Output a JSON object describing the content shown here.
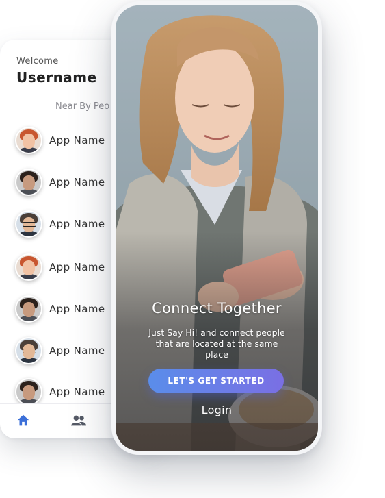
{
  "list_screen": {
    "welcome": "Welcome",
    "username": "Username",
    "section_title": "Near By Peo",
    "items": [
      {
        "label": "App Name",
        "avatar": "red-hair-woman"
      },
      {
        "label": "App Name",
        "avatar": "dark-hair-man"
      },
      {
        "label": "App Name",
        "avatar": "man-with-glasses"
      },
      {
        "label": "App Name",
        "avatar": "red-hair-woman"
      },
      {
        "label": "App Name",
        "avatar": "dark-hair-man"
      },
      {
        "label": "App Name",
        "avatar": "man-with-glasses"
      },
      {
        "label": "App Name",
        "avatar": "dark-hair-man"
      }
    ],
    "tabs": [
      {
        "icon": "home-icon",
        "active": true
      },
      {
        "icon": "people-icon",
        "active": false
      }
    ]
  },
  "onboarding": {
    "headline": "Connect Together",
    "subtext": "Just Say Hi! and connect people that are located at the same place",
    "cta_label": "LET'S GET STARTED",
    "login_label": "Login"
  },
  "colors": {
    "accent_start": "#5a8dea",
    "accent_end": "#7a6fe4",
    "tab_active": "#3b6fd8",
    "tab_inactive": "#555a66"
  }
}
